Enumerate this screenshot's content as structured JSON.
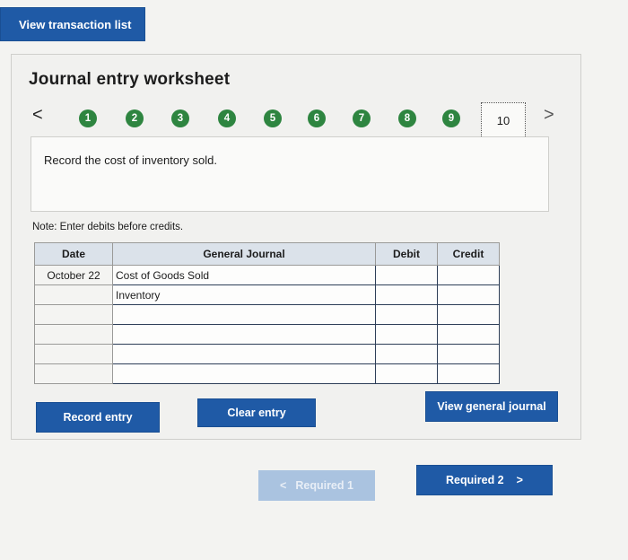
{
  "top_button": "View transaction list",
  "worksheet": {
    "title": "Journal entry worksheet",
    "prev_arrow": "<",
    "next_arrow": ">",
    "steps": [
      "1",
      "2",
      "3",
      "4",
      "5",
      "6",
      "7",
      "8",
      "9",
      "10"
    ],
    "current_step": "10",
    "instruction": "Record the cost of inventory sold.",
    "note": "Note: Enter debits before credits."
  },
  "table": {
    "headers": {
      "date": "Date",
      "account": "General Journal",
      "debit": "Debit",
      "credit": "Credit"
    },
    "rows": [
      {
        "date": "October 22",
        "account": "Cost of Goods Sold",
        "debit": "",
        "credit": ""
      },
      {
        "date": "",
        "account": "Inventory",
        "debit": "",
        "credit": ""
      },
      {
        "date": "",
        "account": "",
        "debit": "",
        "credit": ""
      },
      {
        "date": "",
        "account": "",
        "debit": "",
        "credit": ""
      },
      {
        "date": "",
        "account": "",
        "debit": "",
        "credit": ""
      },
      {
        "date": "",
        "account": "",
        "debit": "",
        "credit": ""
      }
    ]
  },
  "actions": {
    "record_entry": "Record entry",
    "clear_entry": "Clear entry",
    "view_general_journal": "View general journal"
  },
  "pager": {
    "required1": "Required 1",
    "required2": "Required 2",
    "left_chevron": "<",
    "right_chevron": ">"
  },
  "colors": {
    "primary": "#1f5aa6",
    "step_green": "#2e8540",
    "disabled": "#aac3e0"
  }
}
